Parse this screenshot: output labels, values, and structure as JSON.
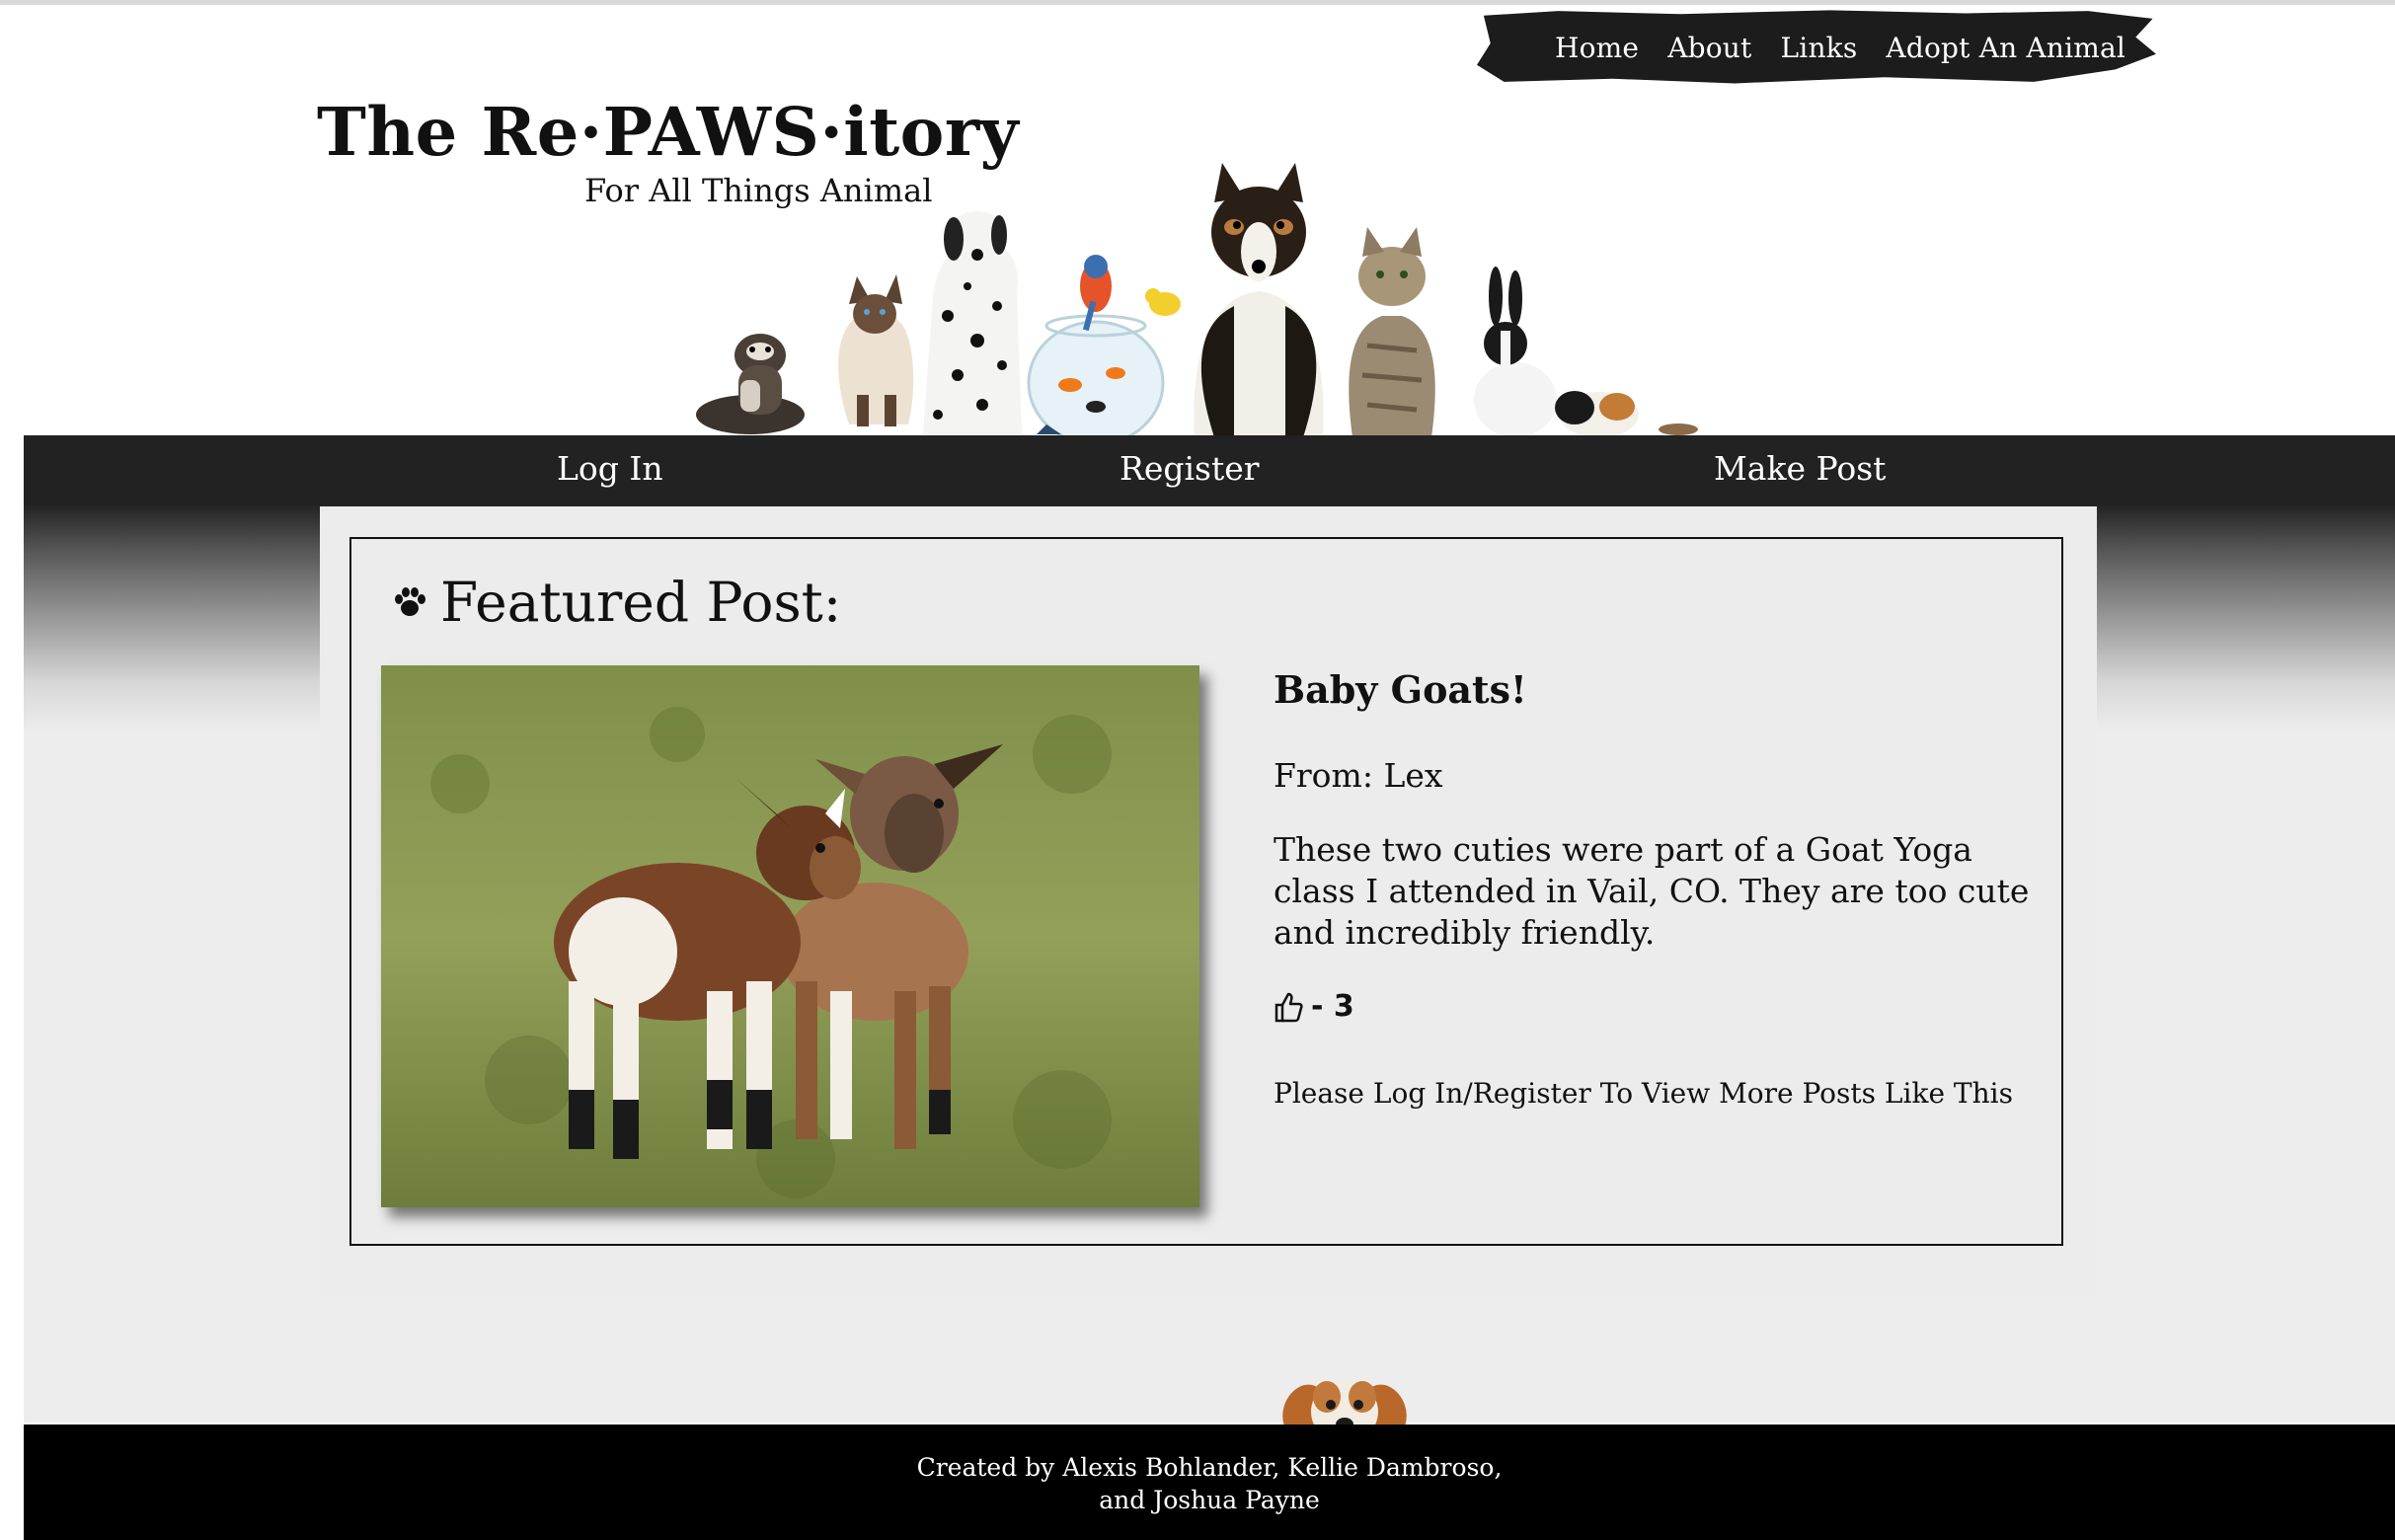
{
  "top_nav": {
    "items": [
      "Home",
      "About",
      "Links",
      "Adopt An Animal"
    ]
  },
  "logo": {
    "title": "The Re·PAWS·itory",
    "subtitle": "For All Things Animal"
  },
  "sub_nav": {
    "items": [
      "Log In",
      "Register",
      "Make Post"
    ]
  },
  "featured": {
    "heading": "Featured Post:",
    "icon": "paw-icon",
    "image_subject": "two baby goats on grass",
    "post": {
      "title": "Baby Goats!",
      "from": "From: Lex",
      "body": "These two cuties were part of a Goat Yoga class I attended in Vail, CO. They are too cute and incredibly friendly.",
      "likes_label": "- 3",
      "likes_icon": "thumbs-up-icon"
    },
    "login_prompt": "Please Log In/Register To View More Posts Like This"
  },
  "footer": {
    "line1": "Created by Alexis Bohlander, Kellie Dambroso,",
    "line2": "and Joshua Payne"
  },
  "colors": {
    "band_dark": "#222222",
    "panel": "#ececec",
    "footer": "#000000"
  }
}
